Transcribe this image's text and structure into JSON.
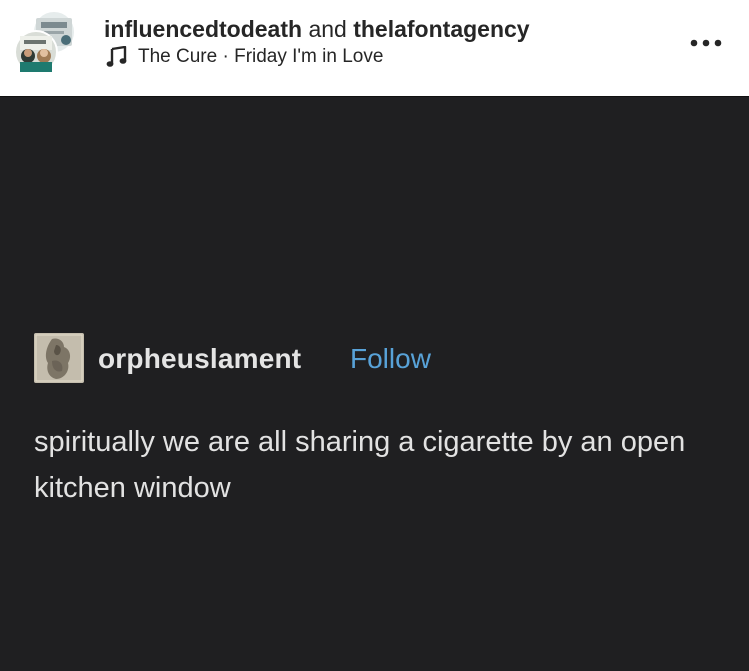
{
  "post": {
    "author_primary": "influencedtodeath",
    "conjunction": "and",
    "author_secondary": "thelafontagency",
    "music": {
      "icon": "music-note-icon",
      "text": "The Cure · Friday I'm in Love"
    },
    "more_icon": "more-options-icon"
  },
  "image": {
    "background": "#1f1f21",
    "tumblr_post": {
      "username": "orpheuslament",
      "follow_label": "Follow",
      "follow_color": "#58a2d8",
      "text": "spiritually we are all sharing a cigarette by an open kitchen window"
    }
  }
}
